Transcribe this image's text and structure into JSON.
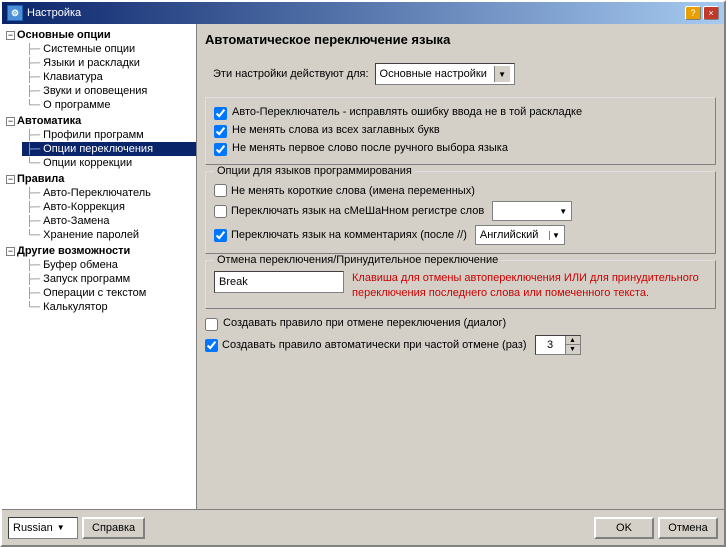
{
  "window": {
    "title": "Настройка",
    "title_icon": "⚙",
    "help_btn": "?",
    "close_btn": "×"
  },
  "sidebar": {
    "sections": [
      {
        "label": "Основные опции",
        "expanded": true,
        "items": [
          "Системные опции",
          "Языки и раскладки",
          "Клавиатура",
          "Звуки и оповещения",
          "О программе"
        ]
      },
      {
        "label": "Автоматика",
        "expanded": true,
        "items": [
          "Профили программ",
          "Опции переключения",
          "Опции коррекции"
        ],
        "selected_index": 1
      },
      {
        "label": "Правила",
        "expanded": true,
        "items": [
          "Авто-Переключатель",
          "Авто-Коррекция",
          "Авто-Замена",
          "Хранение паролей"
        ]
      },
      {
        "label": "Другие возможности",
        "expanded": true,
        "items": [
          "Буфер обмена",
          "Запуск программ",
          "Операции с текстом",
          "Калькулятор"
        ]
      }
    ]
  },
  "main": {
    "title": "Автоматическое переключение языка",
    "applies_label": "Эти настройки действуют для:",
    "applies_value": "Основные настройки",
    "checkboxes": [
      {
        "checked": true,
        "label": "Авто-Переключатель - исправлять ошибку ввода не в той раскладке"
      },
      {
        "checked": true,
        "label": "Не менять слова из всех заглавных букв"
      },
      {
        "checked": true,
        "label": "Не менять первое слово после ручного выбора языка"
      }
    ],
    "prog_group_title": "Опции для языков программирования",
    "prog_checkboxes": [
      {
        "checked": false,
        "label": "Не менять короткие слова (имена переменных)"
      },
      {
        "checked": false,
        "label": "Переключать язык на сМеШаНном регистре слов",
        "has_dropdown": true,
        "dropdown_value": ""
      },
      {
        "checked": true,
        "label": "Переключать язык на комментариях (после //)",
        "has_dropdown": true,
        "dropdown_value": "Английский |"
      }
    ],
    "cancel_group_title": "Отмена переключения/Принудительное переключение",
    "break_value": "Break",
    "cancel_description": "Клавиша для отмены автопереключения ИЛИ для принудительного переключения последнего слова или помеченного текста.",
    "bottom_checkboxes": [
      {
        "checked": false,
        "label": "Создавать правило при отмене переключения (диалог)"
      },
      {
        "checked": true,
        "label": "Создавать правило автоматически при частой отмене (раз)",
        "has_spinner": true,
        "spinner_value": "3"
      }
    ]
  },
  "footer": {
    "lang_value": "Russian",
    "lang_arrow": "▼",
    "help_btn": "Справка",
    "ok_btn": "OK",
    "cancel_btn": "Отмена"
  }
}
